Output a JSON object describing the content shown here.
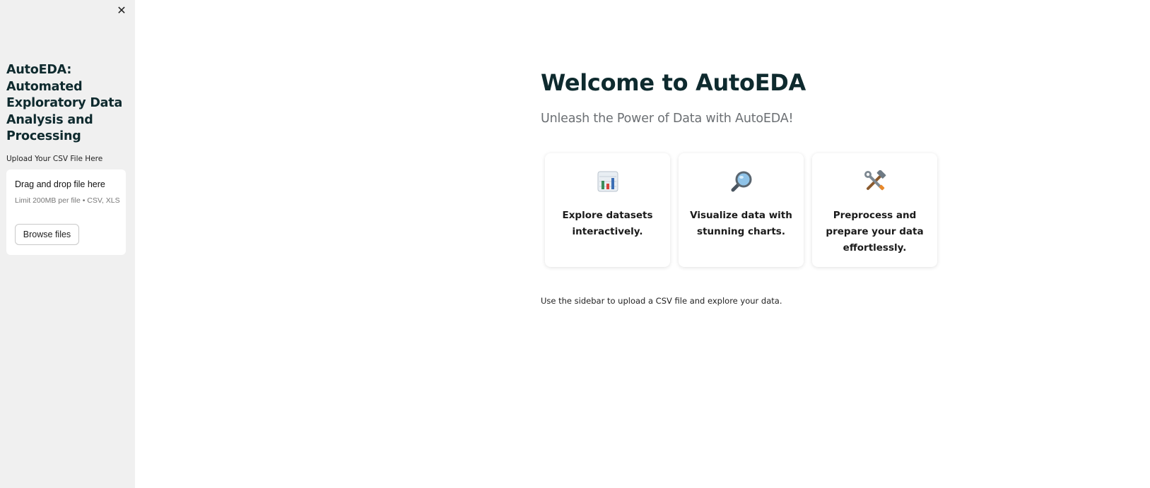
{
  "sidebar": {
    "close_symbol": "✕",
    "app_title": "AutoEDA: Automated Exploratory Data Analysis and Processing",
    "upload_label": "Upload Your CSV File Here",
    "dropzone": {
      "title": "Drag and drop file here",
      "limit": "Limit 200MB per file • CSV, XLS",
      "browse_label": "Browse files"
    }
  },
  "main": {
    "title": "Welcome to AutoEDA",
    "subtitle": "Unleash the Power of Data with AutoEDA!",
    "cards": [
      {
        "icon": "bar-chart-icon",
        "text": "Explore datasets interactively."
      },
      {
        "icon": "magnifier-icon",
        "text": "Visualize data with stunning charts."
      },
      {
        "icon": "hammer-wrench-icon",
        "text": "Preprocess and prepare your data effortlessly."
      }
    ],
    "footer_note": "Use the sidebar to upload a CSV file and explore your data."
  },
  "colors": {
    "sidebar_bg": "#f0f0f0",
    "heading": "#0e2a2e",
    "subtitle": "#6b6f73"
  }
}
